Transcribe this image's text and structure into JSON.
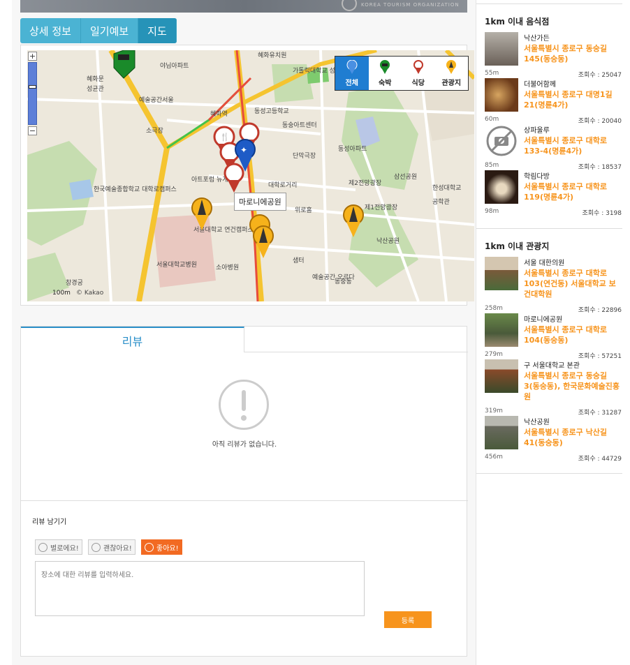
{
  "banner": {
    "org_text": "KOREA TOURISM ORGANIZATION"
  },
  "tabs": [
    {
      "label": "상세 정보",
      "active": false
    },
    {
      "label": "일기예보",
      "active": false
    },
    {
      "label": "지도",
      "active": true
    }
  ],
  "map": {
    "legend": [
      {
        "label": "전체",
        "icon": "globe-pin-icon",
        "active": true
      },
      {
        "label": "숙박",
        "icon": "bed-pin-icon",
        "active": false
      },
      {
        "label": "식당",
        "icon": "fork-pin-icon",
        "active": false
      },
      {
        "label": "관광지",
        "icon": "tower-pin-icon",
        "active": false
      }
    ],
    "tooltip": "마로니에공원",
    "zoom_in": "+",
    "zoom_out": "−",
    "scale": "100m",
    "copyright": "© Kakao",
    "labels": [
      "혜화유치원",
      "가톨릭대학교 성신교정",
      "야님아파트",
      "예술공간서울",
      "동성고등학교",
      "혜화역",
      "동숭아트센터",
      "단막극장",
      "동성아파트",
      "소극장",
      "아트포럼 뉴게이트",
      "대학로거리",
      "한국예술종합학교 대학로캠퍼스",
      "서울대학교 연건캠퍼스",
      "서울대학교병원",
      "소아병원",
      "혜화문",
      "동숭동",
      "낙산공원",
      "제2전망광장",
      "제1전망광장",
      "한성대학교",
      "삼선공원",
      "성균관",
      "창경궁",
      "예술공간 오르다",
      "위로홈",
      "샘터",
      "공학관"
    ],
    "colors": {
      "road_major": "#f5c430",
      "road_red": "#e74c3c",
      "road_green": "#44c24a",
      "park": "#c6ddb0",
      "water": "#a7c7e8"
    }
  },
  "review": {
    "tab_label": "리뷰",
    "empty_text": "아직 리뷰가 없습니다.",
    "leave_title": "리뷰 남기기",
    "ratings": [
      {
        "label": "별로에요!",
        "selected": false
      },
      {
        "label": "괜찮아요!",
        "selected": false
      },
      {
        "label": "좋아요!",
        "selected": true
      }
    ],
    "placeholder": "장소에 대한 리뷰를 입력하세요.",
    "submit_label": "등록"
  },
  "food": {
    "title": "1km 이내 음식점",
    "items": [
      {
        "name": "낙산가든",
        "address": "서울특별시 종로구 동숭길 145(동숭동)",
        "distance": "55m",
        "views": "조회수 : 25047",
        "thumb": "#8a7a6a"
      },
      {
        "name": "더불어함께",
        "address": "서울특별시 종로구 대명1길 21(명륜4가)",
        "distance": "60m",
        "views": "조회수 : 20040",
        "thumb": "#6b4a2a"
      },
      {
        "name": "상파울루",
        "address": "서울특별시 종로구 대학로 133-4(명륜4가)",
        "distance": "85m",
        "views": "조회수 : 18537",
        "thumb": "no-photo"
      },
      {
        "name": "학림다방",
        "address": "서울특별시 종로구 대학로 119(명륜4가)",
        "distance": "98m",
        "views": "조회수 : 3198",
        "thumb": "#3a2a20"
      }
    ]
  },
  "tour": {
    "title": "1km 이내 관광지",
    "items": [
      {
        "name": "서울 대한의원",
        "address": "서울특별시 종로구 대학로 103(연건동) 서울대학교 보건대학원",
        "distance": "258m",
        "views": "조회수 : 22896",
        "thumb": "#8a6a4a"
      },
      {
        "name": "마로니에공원",
        "address": "서울특별시 종로구 대학로 104(동숭동)",
        "distance": "279m",
        "views": "조회수 : 57251",
        "thumb": "#5a6a4a"
      },
      {
        "name": "구 서울대학교 본관",
        "address": "서울특별시 종로구 동숭길 3(동숭동), 한국문화예술진흥원",
        "distance": "319m",
        "views": "조회수 : 31287",
        "thumb": "#7a4a3a"
      },
      {
        "name": "낙산공원",
        "address": "서울특별시 종로구 낙산길 41(동숭동)",
        "distance": "456m",
        "views": "조회수 : 44729",
        "thumb": "#6a6a5a"
      }
    ]
  }
}
